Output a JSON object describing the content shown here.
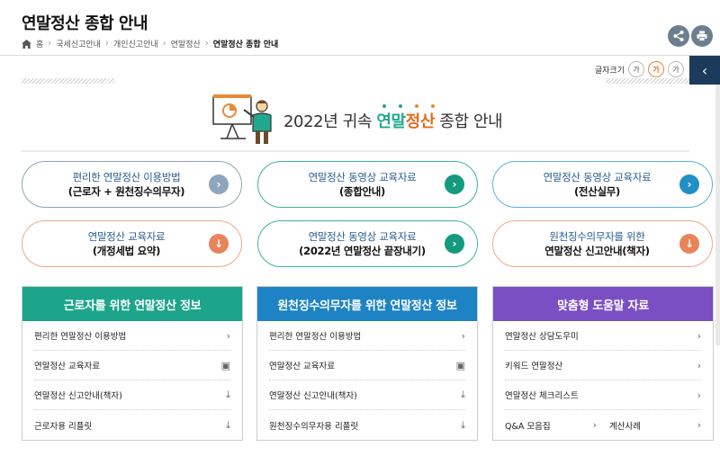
{
  "header": {
    "title": "연말정산 종합 안내",
    "breadcrumb": [
      "홈",
      "국세신고안내",
      "개인신고안내",
      "연말정산",
      "연말정산 종합 안내"
    ],
    "share_icon": "share-icon",
    "print_icon": "print-icon"
  },
  "font_size": {
    "label": "글자크기",
    "options": [
      "가",
      "가",
      "가"
    ]
  },
  "side_tab": "‹",
  "banner": {
    "prefix": "2022년 귀속 ",
    "highlight1": "연말",
    "highlight2": "정산",
    "suffix": " 종합 안내",
    "dot_colors": [
      "#20a88f",
      "#20a88f",
      "#e48a39",
      "#e48a39"
    ]
  },
  "pills": [
    {
      "line1": "편리한 연말정산 이용방법",
      "line2": "(근로자 + 원천징수의무자)",
      "icon": "›",
      "icon_color": "#8fa4be",
      "border": "#8fa4be"
    },
    {
      "line1": "연말정산 동영상 교육자료",
      "line2": "(종합안내)",
      "icon": "›",
      "icon_color": "#139a7f",
      "border": "#3db29b"
    },
    {
      "line1": "연말정산 동영상 교육자료",
      "line2": "(전산실무)",
      "icon": "›",
      "icon_color": "#1f8fc4",
      "border": "#5db1d9"
    },
    {
      "line1": "연말정산 교육자료",
      "line2": "(개정세법 요약)",
      "icon": "↓",
      "icon_color": "#e9845a",
      "border": "#f0a784"
    },
    {
      "line1": "연말정산 동영상 교육자료",
      "line2": "(2022년 연말정산 끝장내기)",
      "icon": "›",
      "icon_color": "#139a7f",
      "border": "#3db29b"
    },
    {
      "line1": "원천징수의무자를 위한",
      "line2": "연말정산 신고안내(책자)",
      "icon": "↓",
      "icon_color": "#e9845a",
      "border": "#f0a784"
    }
  ],
  "panels": [
    {
      "title": "근로자를 위한 연말정산 정보",
      "color": "#1ca58b",
      "rows": [
        {
          "label": "편리한 연말정산 이용방법",
          "icon": "›"
        },
        {
          "label": "연말정산 교육자료",
          "icon": "▣"
        },
        {
          "label": "연말정산 신고안내(책자)",
          "icon": "⤓"
        },
        {
          "label": "근로자용 리플릿",
          "icon": "⤓"
        }
      ]
    },
    {
      "title": "원천징수의무자를 위한 연말정산 정보",
      "color": "#1d83c5",
      "rows": [
        {
          "label": "편리한 연말정산 이용방법",
          "icon": "›"
        },
        {
          "label": "연말정산 교육자료",
          "icon": "▣"
        },
        {
          "label": "연말정산 신고안내(책자)",
          "icon": "⤓"
        },
        {
          "label": "원천징수의무자용 리플릿",
          "icon": "⤓"
        }
      ]
    },
    {
      "title": "맞춤형 도움말 자료",
      "color": "#7a4fc4",
      "rows": [
        {
          "label": "연말정산 상담도우미",
          "icon": "›"
        },
        {
          "label": "키워드 연말정산",
          "icon": "›"
        },
        {
          "label": "연말정산 체크리스트",
          "icon": "›"
        }
      ],
      "last_row": {
        "label_a": "Q&A 모음집",
        "icon_a": "›",
        "label_b": "계산사례",
        "icon_b": "›"
      }
    }
  ]
}
